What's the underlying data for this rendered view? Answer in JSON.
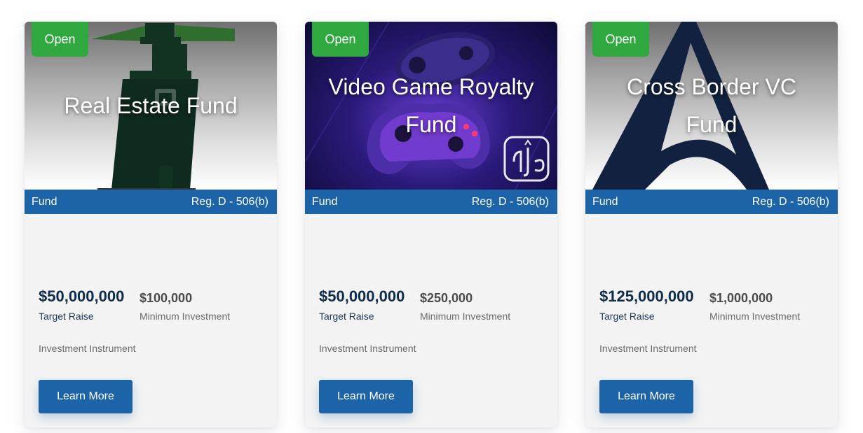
{
  "cards": [
    {
      "badge": "Open",
      "title": "Real Estate Fund",
      "type": "Fund",
      "regulation": "Reg. D - 506(b)",
      "target_raise": "$50,000,000",
      "target_label": "Target Raise",
      "min_investment": "$100,000",
      "min_label": "Minimum Investment",
      "instrument_label": "Investment Instrument",
      "button": "Learn More",
      "hero_icon": "lighthouse-image"
    },
    {
      "badge": "Open",
      "title": "Video Game Royalty Fund",
      "type": "Fund",
      "regulation": "Reg. D - 506(b)",
      "target_raise": "$50,000,000",
      "target_label": "Target Raise",
      "min_investment": "$250,000",
      "min_label": "Minimum Investment",
      "instrument_label": "Investment Instrument",
      "button": "Learn More",
      "hero_icon": "game-controller-image"
    },
    {
      "badge": "Open",
      "title": "Cross Border VC Fund",
      "type": "Fund",
      "regulation": "Reg. D - 506(b)",
      "target_raise": "$125,000,000",
      "target_label": "Target Raise",
      "min_investment": "$1,000,000",
      "min_label": "Minimum Investment",
      "instrument_label": "Investment Instrument",
      "button": "Learn More",
      "hero_icon": "letter-a-logo-image"
    }
  ],
  "colors": {
    "badge_green": "#2fa83f",
    "strip_blue": "#1d63a8",
    "card_bg": "#f3f3f3",
    "value_navy": "#0d2b4a"
  }
}
